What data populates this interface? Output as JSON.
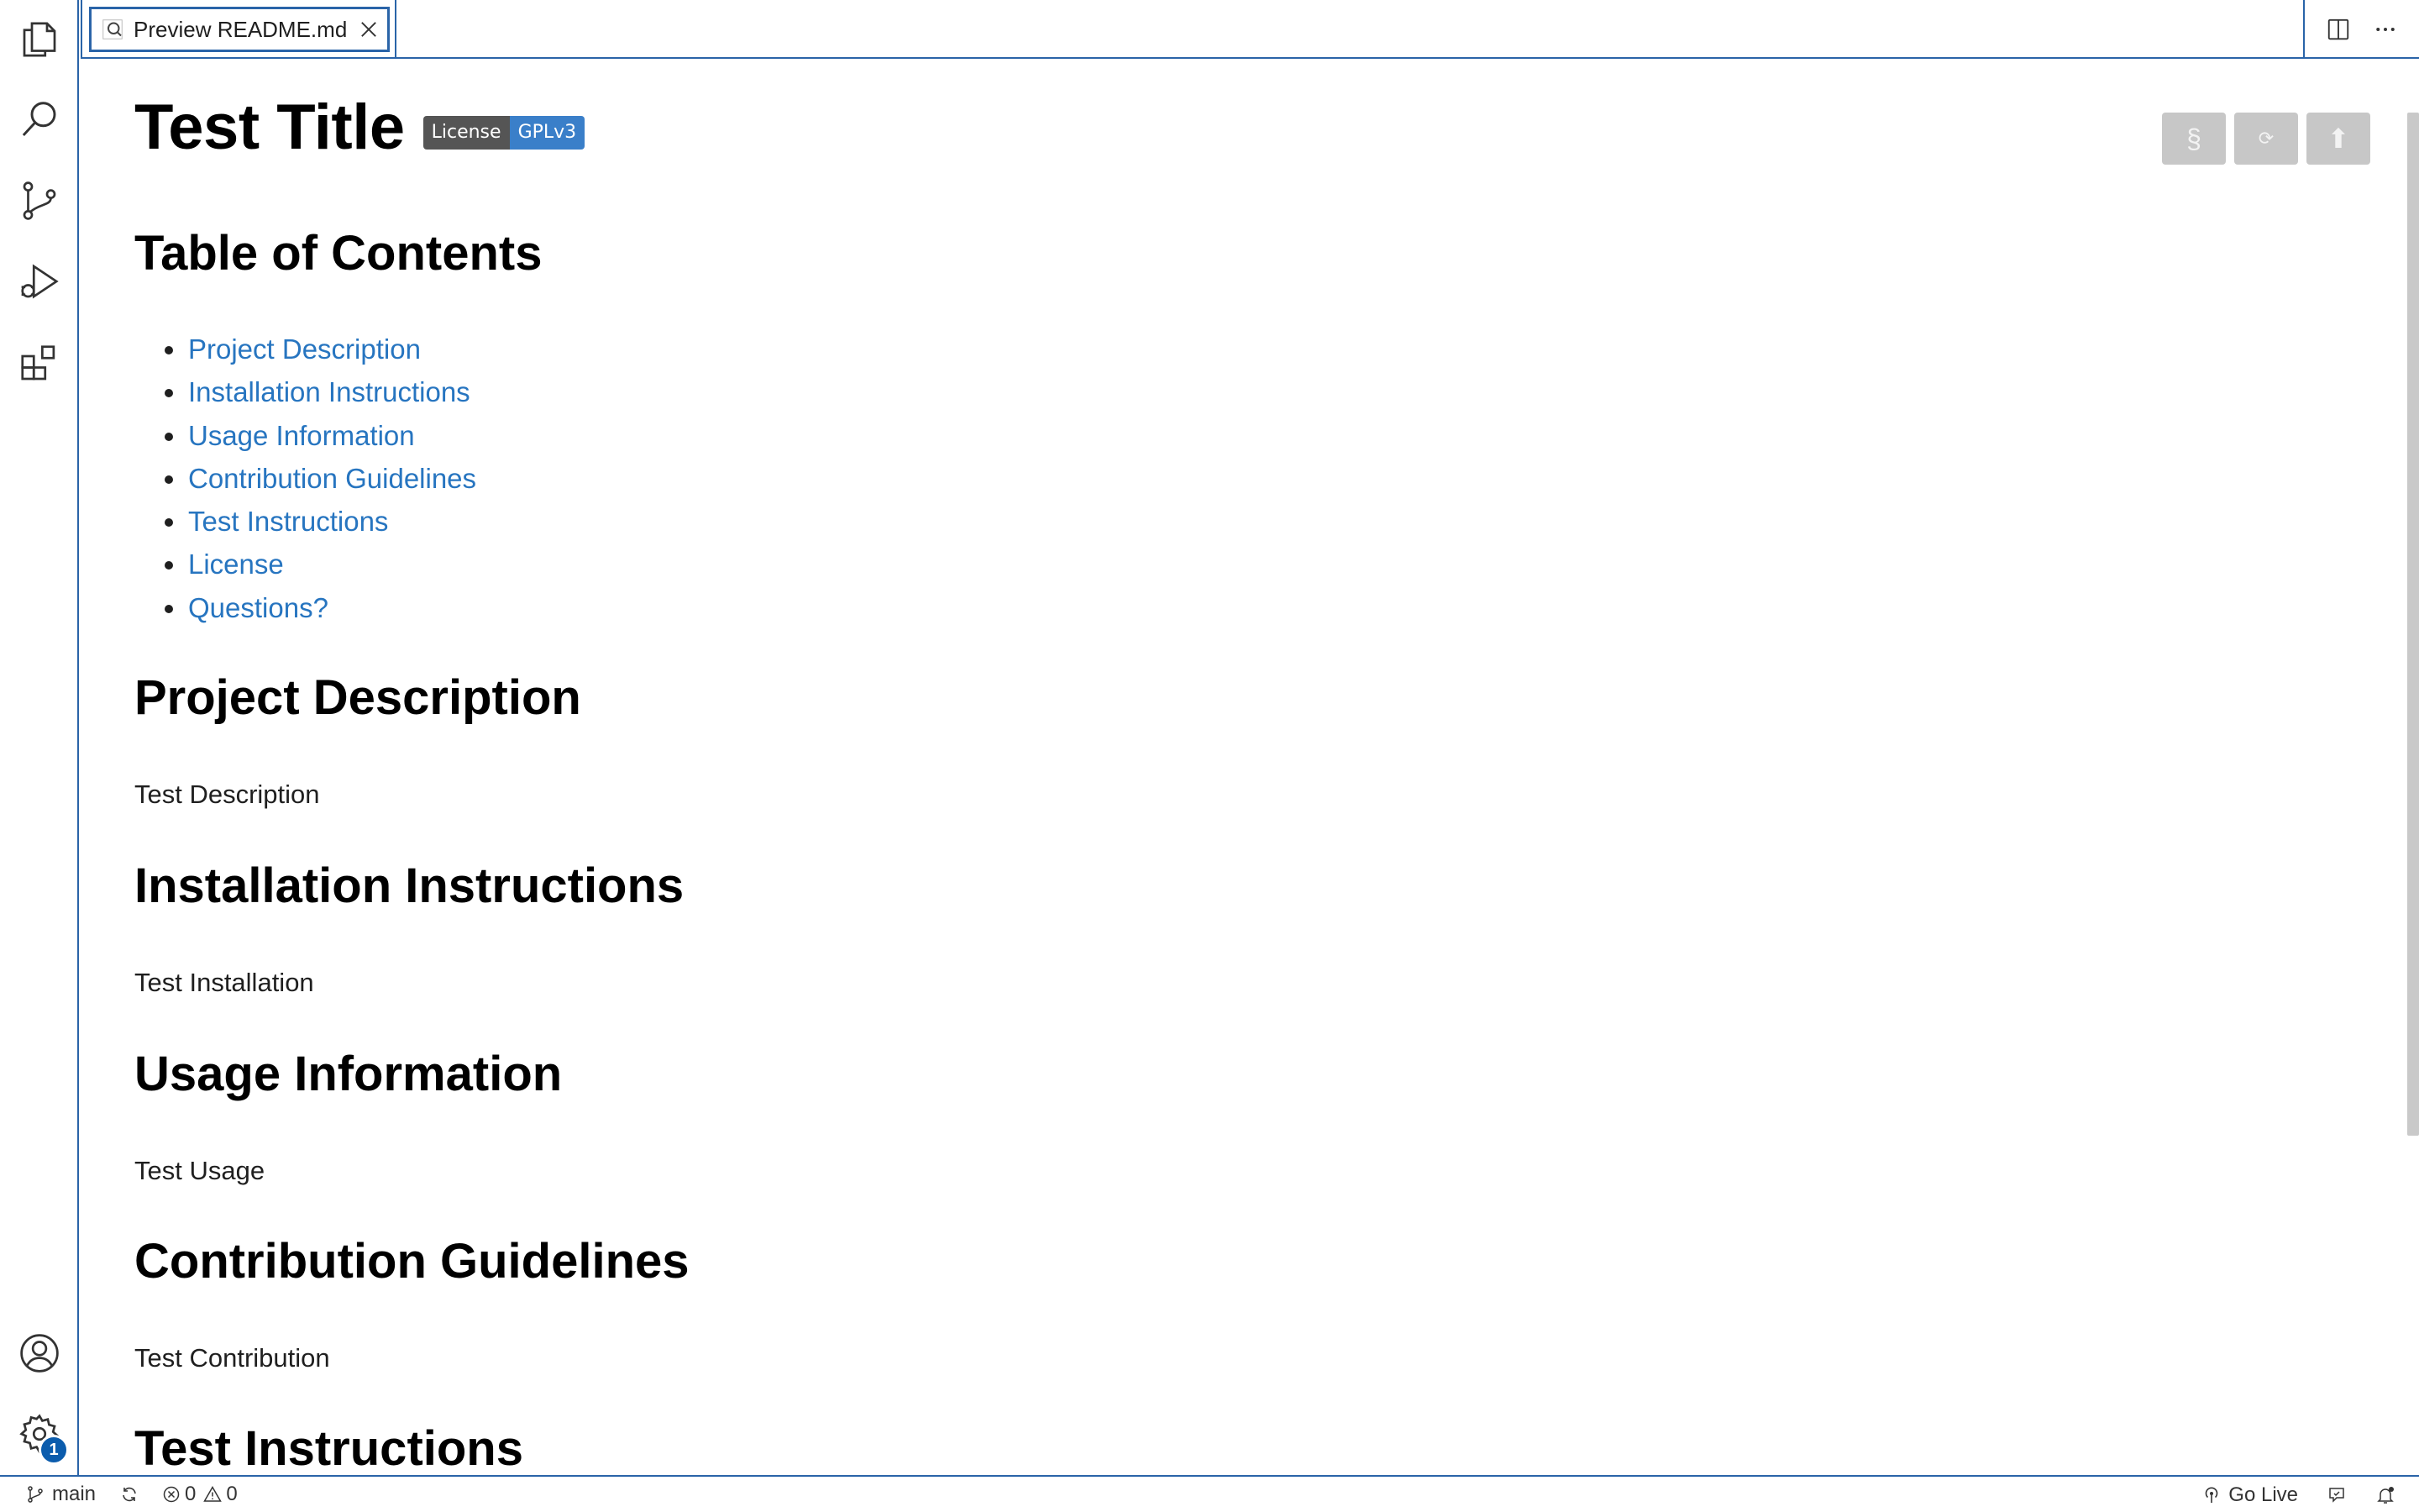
{
  "tab": {
    "label": "Preview README.md"
  },
  "document": {
    "title": "Test Title",
    "badge": {
      "left": "License",
      "right": "GPLv3"
    },
    "toc_heading": "Table of Contents",
    "toc": [
      "Project Description",
      "Installation Instructions",
      "Usage Information",
      "Contribution Guidelines",
      "Test Instructions",
      "License",
      "Questions?"
    ],
    "sections": [
      {
        "heading": "Project Description",
        "text": "Test Description"
      },
      {
        "heading": "Installation Instructions",
        "text": "Test Installation"
      },
      {
        "heading": "Usage Information",
        "text": "Test Usage"
      },
      {
        "heading": "Contribution Guidelines",
        "text": "Test Contribution"
      },
      {
        "heading": "Test Instructions",
        "text": ""
      }
    ]
  },
  "preview_tools": [
    "§",
    "⟳",
    "⬆"
  ],
  "activity": {
    "settings_badge": "1"
  },
  "status": {
    "branch": "main",
    "errors": "0",
    "warnings": "0",
    "go_live": "Go Live"
  },
  "colors": {
    "accent": "#2a64a8",
    "link": "#2775c0",
    "badge_right": "#3a7fc9"
  }
}
